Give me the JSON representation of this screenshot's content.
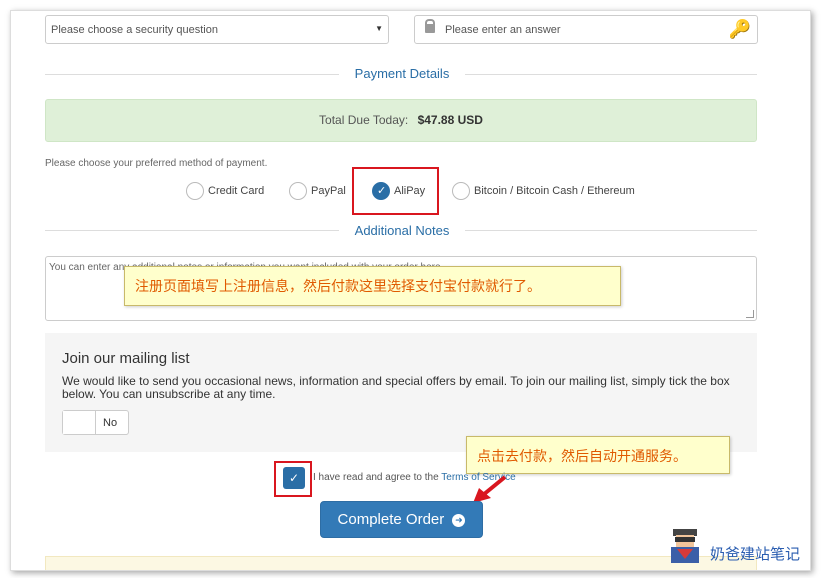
{
  "security": {
    "question_placeholder": "Please choose a security question",
    "answer_placeholder": "Please enter an answer"
  },
  "payment": {
    "section_title": "Payment Details",
    "total_label": "Total Due Today:",
    "total_value": "$47.88 USD",
    "method_prompt": "Please choose your preferred method of payment.",
    "methods": [
      {
        "label": "Credit Card",
        "selected": false
      },
      {
        "label": "PayPal",
        "selected": false
      },
      {
        "label": "AliPay",
        "selected": true
      },
      {
        "label": "Bitcoin / Bitcoin Cash / Ethereum",
        "selected": false
      }
    ]
  },
  "notes": {
    "section_title": "Additional Notes",
    "placeholder": "You can enter any additional notes or information you want included with your order here..."
  },
  "callouts": {
    "register": "注册页面填写上注册信息，然后付款这里选择支付宝付款就行了。",
    "pay": "点击去付款，然后自动开通服务。"
  },
  "mailing": {
    "title": "Join our mailing list",
    "text": "We would like to send you occasional news, information and special offers by email. To join our mailing list, simply tick the box below. You can unsubscribe at any time.",
    "toggle_label": "No"
  },
  "agree": {
    "prefix": "I have read and agree to the",
    "link": "Terms of Service"
  },
  "complete_button": "Complete Order",
  "watermark": "奶爸建站笔记",
  "colors": {
    "accent": "#337ab7",
    "success_bg": "#dff0d8",
    "highlight": "#d9161f",
    "callout_bg": "#ffffcc"
  }
}
